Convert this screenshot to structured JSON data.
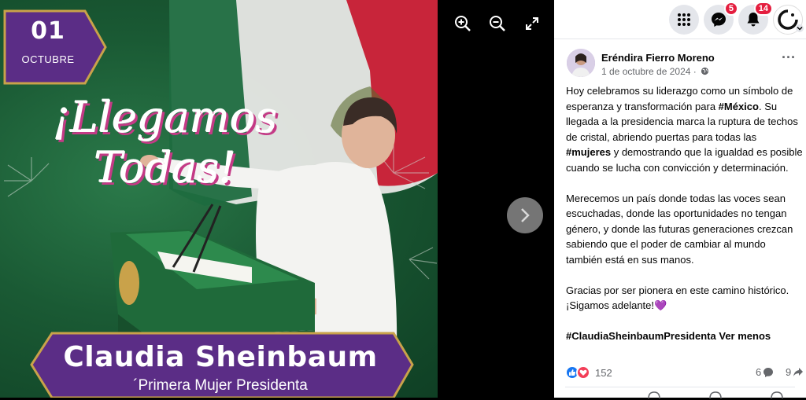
{
  "viewer": {
    "date_day": "01",
    "date_month": "OCTUBRE",
    "headline": "¡Llegamos Todas!",
    "name": "Claudia Sheinbaum",
    "subtitle": "´Primera Mujer Presidenta",
    "controls": [
      "zoom-in-icon",
      "zoom-out-icon",
      "fullscreen-icon",
      "next-arrow-icon"
    ]
  },
  "topbar": {
    "messenger_badge": "5",
    "notifications_badge": "14"
  },
  "post": {
    "author": "Eréndira Fierro Moreno",
    "date": "1 de octubre de 2024 ·",
    "p1_a": "Hoy celebramos su liderazgo como un símbolo de esperanza y transformación para ",
    "p1_tag1": "#México",
    "p1_b": ". Su llegada a la presidencia marca la ruptura de techos de cristal, abriendo puertas para todas las ",
    "p1_tag2": "#mujeres",
    "p1_c": " y demostrando que la igualdad es posible cuando se lucha con convicción y determinación.",
    "p2": "Merecemos un país donde todas las voces sean escuchadas, donde las oportunidades no tengan género, y donde las futuras generaciones crezcan sabiendo que el poder de cambiar al mundo también está en sus manos.",
    "p3": "Gracias por ser pionera en este camino histórico. ¡Sigamos adelante!💜",
    "hashtag": "#ClaudiaSheinbaumPresidenta",
    "see_less": "Ver menos",
    "reactions_count": "152",
    "comments_count": "6",
    "shares_count": "9"
  },
  "colors": {
    "purple": "#5b2d86",
    "gold": "#c9a24a",
    "flag_green": "#1e6b3f",
    "flag_red": "#c8253a",
    "like_blue": "#1877f2",
    "love_red": "#f33e58",
    "badge_red": "#e41e3f"
  }
}
